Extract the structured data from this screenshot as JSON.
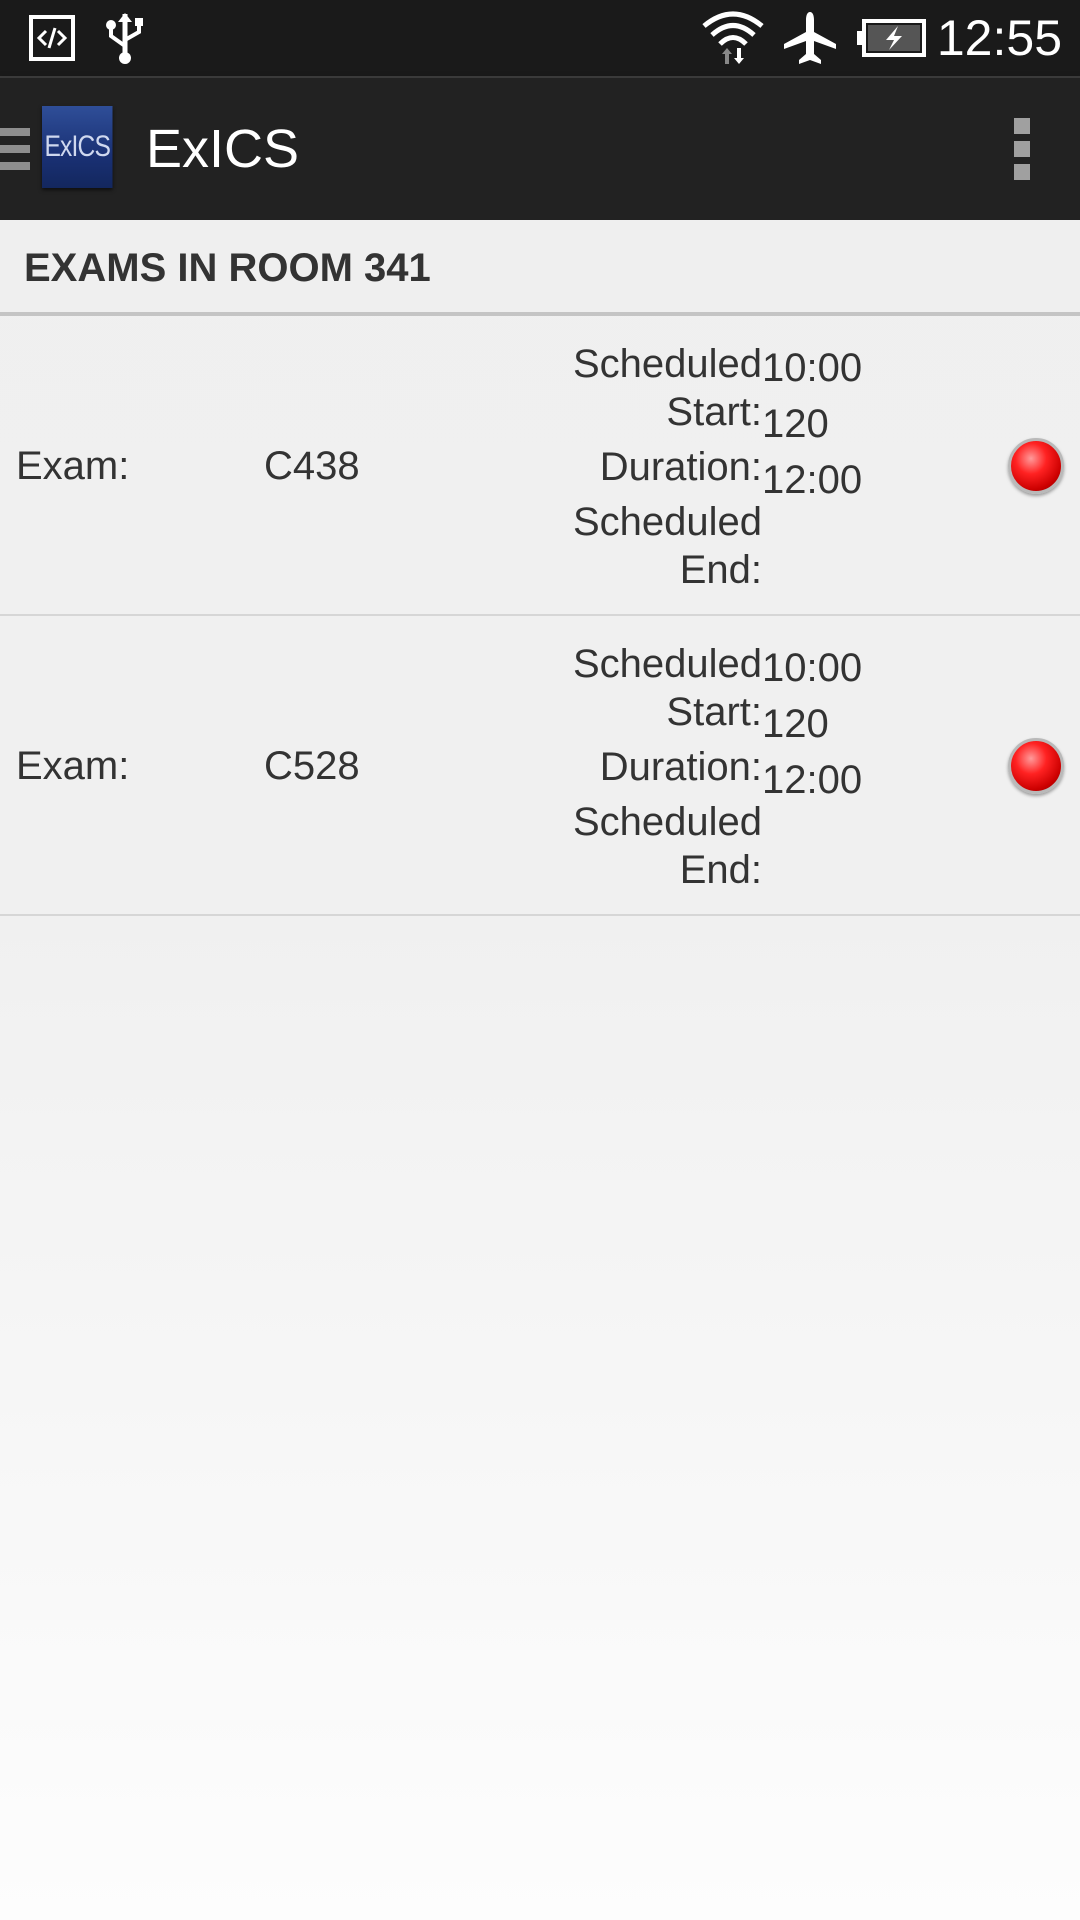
{
  "status_bar": {
    "time": "12:55",
    "icons": [
      "developer-mode-icon",
      "usb-icon",
      "wifi-icon",
      "airplane-icon",
      "battery-charging-icon"
    ]
  },
  "action_bar": {
    "logo_text": "ExICS",
    "title": "ExICS"
  },
  "section": {
    "title": "EXAMS IN ROOM 341"
  },
  "exams": [
    {
      "label": "Exam:",
      "code": "C438",
      "scheduled_start_label_1": "Scheduled",
      "scheduled_start_label_2": "Start:",
      "duration_label": "Duration:",
      "scheduled_end_label_1": "Scheduled",
      "scheduled_end_label_2": "End:",
      "value_1": "10:00",
      "value_2": "120",
      "value_3": "12:00",
      "status_color": "#e00000"
    },
    {
      "label": "Exam:",
      "code": "C528",
      "scheduled_start_label_1": "Scheduled",
      "scheduled_start_label_2": "Start:",
      "duration_label": "Duration:",
      "scheduled_end_label_1": "Scheduled",
      "scheduled_end_label_2": "End:",
      "value_1": "10:00",
      "value_2": "120",
      "value_3": "12:00",
      "status_color": "#e00000"
    }
  ]
}
